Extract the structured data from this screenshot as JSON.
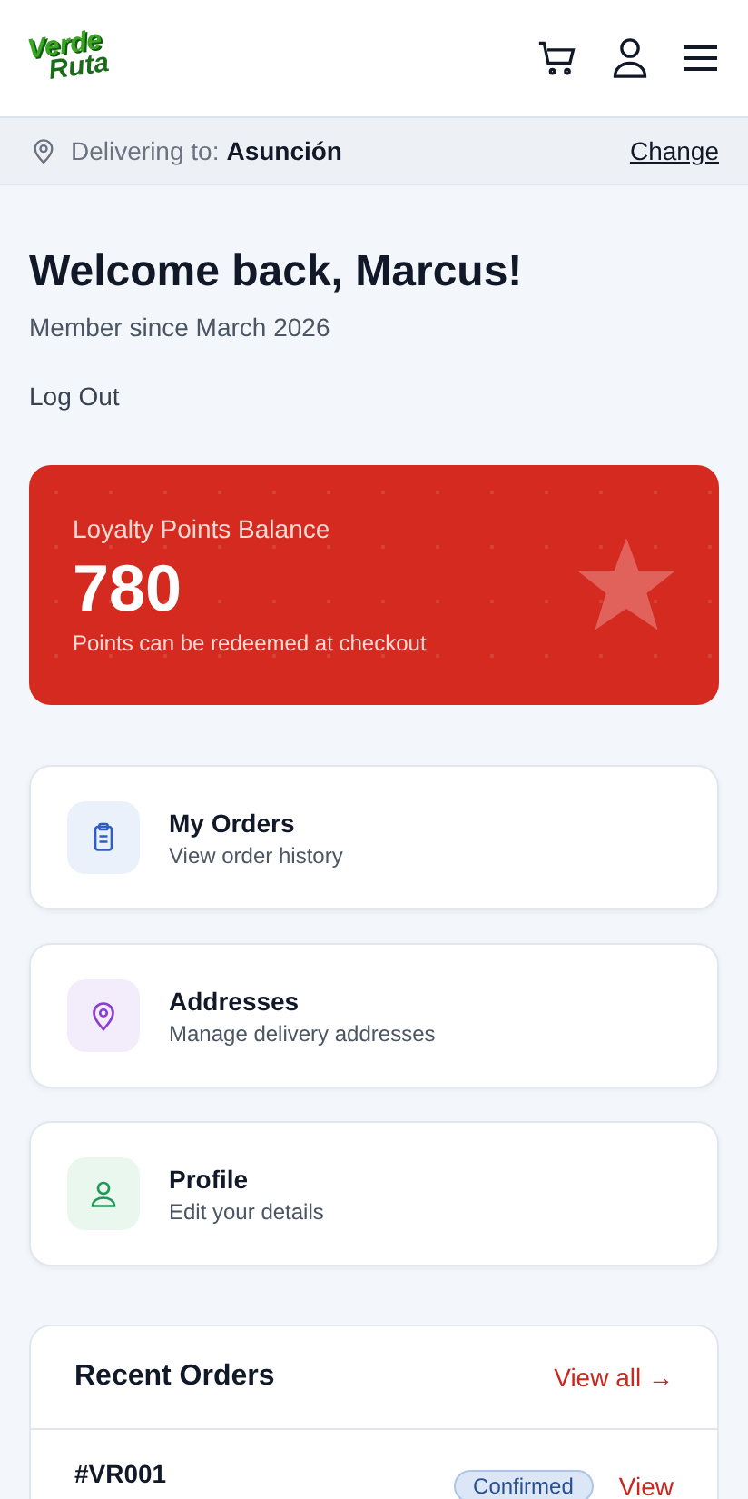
{
  "header": {
    "logo": [
      "Verde",
      "Ruta"
    ]
  },
  "delivery_bar": {
    "label": "Delivering to:",
    "city": "Asunción",
    "action": "Change"
  },
  "welcome": {
    "title": "Welcome back, Marcus!",
    "member_since": "Member since March 2026",
    "logout": "Log Out"
  },
  "loyalty_card": {
    "title": "Loyalty Points Balance",
    "points": "780",
    "note": "Points can be redeemed at checkout"
  },
  "menu_items": [
    {
      "kind": "orders",
      "title": "My Orders",
      "subtitle": "View order history"
    },
    {
      "kind": "addresses",
      "title": "Addresses",
      "subtitle": "Manage delivery addresses"
    },
    {
      "kind": "profile",
      "title": "Profile",
      "subtitle": "Edit your details"
    }
  ],
  "recent_orders": {
    "title": "Recent Orders",
    "view_all": "View all →",
    "orders": [
      {
        "id": "#VR001",
        "status": "Confirmed",
        "action": "View"
      }
    ]
  }
}
